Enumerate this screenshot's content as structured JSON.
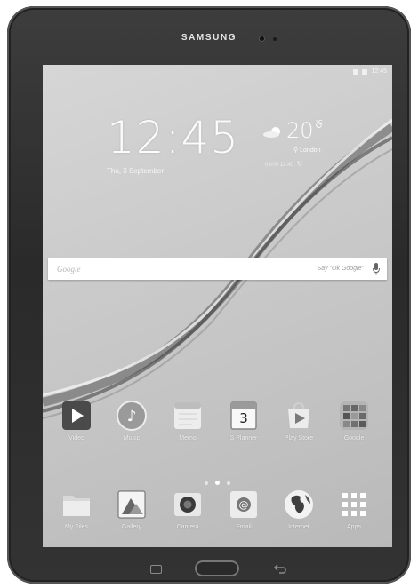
{
  "device": {
    "brand": "SAMSUNG"
  },
  "status_bar": {
    "time": "12:45"
  },
  "lockscreen": {
    "clock": "12:45",
    "date": "Thu, 3 September",
    "weather": {
      "temperature": "20°",
      "unit": "°C",
      "location": "London",
      "updated": "03/09 12:40"
    }
  },
  "search": {
    "logo": "Google",
    "hint": "Say \"Ok Google\""
  },
  "apps": [
    {
      "label": "Video",
      "icon": "video-icon"
    },
    {
      "label": "Music",
      "icon": "music-icon"
    },
    {
      "label": "Memo",
      "icon": "memo-icon"
    },
    {
      "label": "S Planner",
      "icon": "calendar-icon",
      "badge": "3"
    },
    {
      "label": "Play Store",
      "icon": "play-store-icon"
    },
    {
      "label": "Google",
      "icon": "google-folder-icon"
    }
  ],
  "dock": [
    {
      "label": "My Files",
      "icon": "folder-icon"
    },
    {
      "label": "Gallery",
      "icon": "gallery-icon"
    },
    {
      "label": "Camera",
      "icon": "camera-icon"
    },
    {
      "label": "Email",
      "icon": "email-icon"
    },
    {
      "label": "Internet",
      "icon": "globe-icon"
    },
    {
      "label": "Apps",
      "icon": "apps-grid-icon"
    }
  ],
  "pager": {
    "pages": 3,
    "active": 2
  },
  "colors": {
    "bezel": "#2f2f2f",
    "screen": "#c8c8c8",
    "label": "#f4f4f4"
  }
}
